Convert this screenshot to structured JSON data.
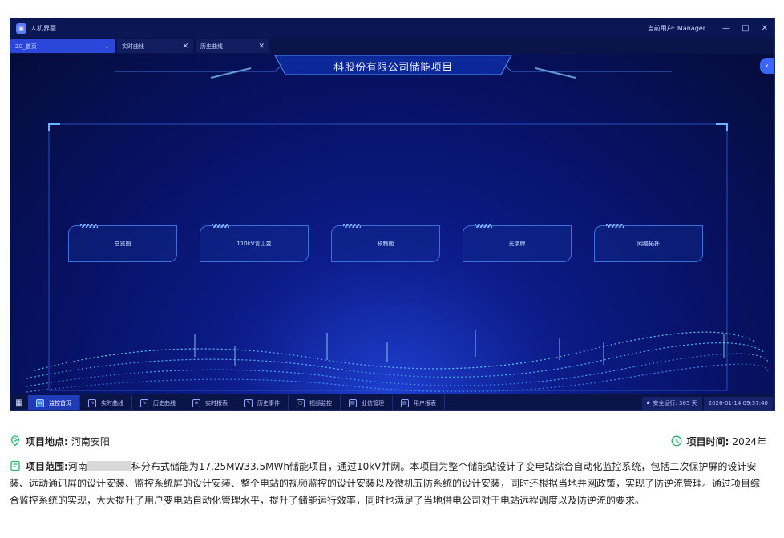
{
  "window": {
    "title": "人机界面",
    "user": "当前用户: Manager",
    "minimize": "—",
    "maximize": "□",
    "close": "✕"
  },
  "tabs": [
    {
      "label": "Z0_首页",
      "close": "⌄"
    },
    {
      "label": "实时曲线",
      "close": "✕"
    },
    {
      "label": "历史曲线",
      "close": "✕"
    }
  ],
  "header": {
    "title": "科股份有限公司储能项目",
    "back": "‹"
  },
  "nav_cards": [
    {
      "label": "总览图"
    },
    {
      "label": "110kV青山变"
    },
    {
      "label": "预制舱"
    },
    {
      "label": "光字牌"
    },
    {
      "label": "网络拓扑"
    }
  ],
  "taskbar": {
    "items": [
      {
        "label": "监控首页",
        "icon": "home-icon",
        "active": true
      },
      {
        "label": "实时曲线",
        "icon": "realtime-curve-icon",
        "active": false
      },
      {
        "label": "历史曲线",
        "icon": "history-curve-icon",
        "active": false
      },
      {
        "label": "实时报表",
        "icon": "report-icon",
        "active": false
      },
      {
        "label": "历史事件",
        "icon": "event-icon",
        "active": false
      },
      {
        "label": "视频监控",
        "icon": "video-icon",
        "active": false
      },
      {
        "label": "业信管理",
        "icon": "manage-icon",
        "active": false
      },
      {
        "label": "用户报表",
        "icon": "user-report-icon",
        "active": false
      }
    ],
    "safe_run": "安全运行: 365 天",
    "datetime": "2026-01-14 09:37:40"
  },
  "info": {
    "location_label": "项目地点:",
    "location_value": "河南安阳",
    "time_label": "项目时间:",
    "time_value": "2024年",
    "scope_label": "项目范围:",
    "scope_prefix": "河南",
    "scope_text": "科分布式储能为17.25MW33.5MWh储能项目，通过10kV并网。本项目为整个储能站设计了变电站综合自动化监控系统，包括二次保护屏的设计安装、远动通讯屏的设计安装、监控系统屏的设计安装、整个电站的视频监控的设计安装以及微机五防系统的设计安装，同时还根据当地并网政策，实现了防逆流管理。通过项目综合监控系统的实现，大大提升了用户变电站自动化管理水平，提升了储能运行效率，同时也满足了当地供电公司对于电站远程调度以及防逆流的要求。"
  },
  "colors": {
    "accent": "#2a47d9",
    "background": "#050c3a",
    "info_icon": "#27b36a"
  }
}
